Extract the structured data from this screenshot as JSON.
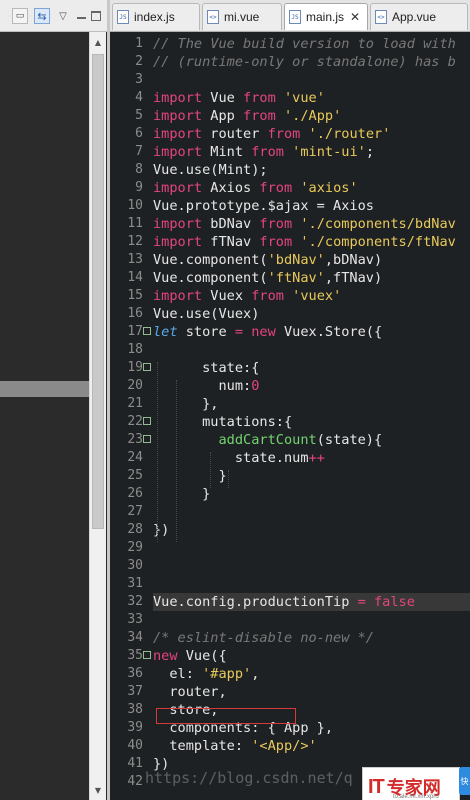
{
  "explorer": {
    "toolbar": {
      "collapse_icon": "collapse-all-icon",
      "link_icon": "link-with-editor-icon",
      "menu_icon": "view-menu-icon",
      "minimize_icon": "minimize-icon",
      "maximize_icon": "maximize-icon"
    },
    "scroll_up_glyph": "▲",
    "scroll_down_glyph": "▼"
  },
  "tabs": [
    {
      "label": "index.js",
      "icon": "js-file-icon",
      "active": false
    },
    {
      "label": "mi.vue",
      "icon": "vue-file-icon",
      "active": false
    },
    {
      "label": "main.js",
      "icon": "js-file-icon",
      "active": true,
      "close": "✕"
    },
    {
      "label": "App.vue",
      "icon": "vue-file-icon",
      "active": false
    }
  ],
  "editor": {
    "lines": [
      {
        "n": "1",
        "tokens": [
          [
            "com",
            "// The Vue build version to load with"
          ]
        ]
      },
      {
        "n": "2",
        "tokens": [
          [
            "com",
            "// (runtime-only or standalone) has b"
          ]
        ]
      },
      {
        "n": "3",
        "tokens": []
      },
      {
        "n": "4",
        "tokens": [
          [
            "kw",
            "import"
          ],
          [
            "txt",
            " Vue "
          ],
          [
            "kw",
            "from"
          ],
          [
            "txt",
            " "
          ],
          [
            "str",
            "'vue'"
          ]
        ]
      },
      {
        "n": "5",
        "tokens": [
          [
            "kw",
            "import"
          ],
          [
            "txt",
            " App "
          ],
          [
            "kw",
            "from"
          ],
          [
            "txt",
            " "
          ],
          [
            "str",
            "'./App'"
          ]
        ]
      },
      {
        "n": "6",
        "tokens": [
          [
            "kw",
            "import"
          ],
          [
            "txt",
            " router "
          ],
          [
            "kw",
            "from"
          ],
          [
            "txt",
            " "
          ],
          [
            "str",
            "'./router'"
          ]
        ]
      },
      {
        "n": "7",
        "tokens": [
          [
            "kw",
            "import"
          ],
          [
            "txt",
            " Mint "
          ],
          [
            "kw",
            "from"
          ],
          [
            "txt",
            " "
          ],
          [
            "str",
            "'mint-ui'"
          ],
          [
            "txt",
            ";"
          ]
        ]
      },
      {
        "n": "8",
        "tokens": [
          [
            "txt",
            "Vue.use(Mint);"
          ]
        ]
      },
      {
        "n": "9",
        "tokens": [
          [
            "kw",
            "import"
          ],
          [
            "txt",
            " Axios "
          ],
          [
            "kw",
            "from"
          ],
          [
            "txt",
            " "
          ],
          [
            "str",
            "'axios'"
          ]
        ]
      },
      {
        "n": "10",
        "tokens": [
          [
            "txt",
            "Vue.prototype.$ajax = Axios"
          ]
        ]
      },
      {
        "n": "11",
        "tokens": [
          [
            "kw",
            "import"
          ],
          [
            "txt",
            " bDNav "
          ],
          [
            "kw",
            "from"
          ],
          [
            "txt",
            " "
          ],
          [
            "str",
            "'./components/bdNav"
          ]
        ]
      },
      {
        "n": "12",
        "tokens": [
          [
            "kw",
            "import"
          ],
          [
            "txt",
            " fTNav "
          ],
          [
            "kw",
            "from"
          ],
          [
            "txt",
            " "
          ],
          [
            "str",
            "'./components/ftNav"
          ]
        ]
      },
      {
        "n": "13",
        "tokens": [
          [
            "txt",
            "Vue.component("
          ],
          [
            "str",
            "'bdNav'"
          ],
          [
            "txt",
            ",bDNav)"
          ]
        ]
      },
      {
        "n": "14",
        "tokens": [
          [
            "txt",
            "Vue.component("
          ],
          [
            "str",
            "'ftNav'"
          ],
          [
            "txt",
            ",fTNav)"
          ]
        ]
      },
      {
        "n": "15",
        "tokens": [
          [
            "kw",
            "import"
          ],
          [
            "txt",
            " Vuex "
          ],
          [
            "kw",
            "from"
          ],
          [
            "txt",
            " "
          ],
          [
            "str",
            "'vuex'"
          ]
        ]
      },
      {
        "n": "16",
        "tokens": [
          [
            "txt",
            "Vue.use(Vuex)"
          ]
        ]
      },
      {
        "n": "17",
        "fold": true,
        "tokens": [
          [
            "kwi",
            "let"
          ],
          [
            "txt",
            " store "
          ],
          [
            "op",
            "="
          ],
          [
            "txt",
            " "
          ],
          [
            "kw",
            "new"
          ],
          [
            "txt",
            " Vuex.Store({"
          ]
        ]
      },
      {
        "n": "18",
        "tokens": []
      },
      {
        "n": "19",
        "fold": true,
        "tokens": [
          [
            "txt",
            "      state:{"
          ]
        ]
      },
      {
        "n": "20",
        "tokens": [
          [
            "txt",
            "        num:"
          ],
          [
            "num",
            "0"
          ]
        ]
      },
      {
        "n": "21",
        "tokens": [
          [
            "txt",
            "      },"
          ]
        ]
      },
      {
        "n": "22",
        "fold": true,
        "tokens": [
          [
            "txt",
            "      mutations:{"
          ]
        ]
      },
      {
        "n": "23",
        "fold": true,
        "tokens": [
          [
            "txt",
            "        "
          ],
          [
            "fn",
            "addCartCount"
          ],
          [
            "txt",
            "(state){"
          ]
        ]
      },
      {
        "n": "24",
        "tokens": [
          [
            "txt",
            "          state.num"
          ],
          [
            "op",
            "++"
          ]
        ]
      },
      {
        "n": "25",
        "tokens": [
          [
            "txt",
            "        }"
          ]
        ]
      },
      {
        "n": "26",
        "tokens": [
          [
            "txt",
            "      }"
          ]
        ]
      },
      {
        "n": "27",
        "tokens": []
      },
      {
        "n": "28",
        "tokens": [
          [
            "txt",
            "})"
          ]
        ]
      },
      {
        "n": "29",
        "tokens": []
      },
      {
        "n": "30",
        "tokens": []
      },
      {
        "n": "31",
        "tokens": []
      },
      {
        "n": "32",
        "highlight": true,
        "tokens": [
          [
            "txt",
            "Vue.config.productionTip "
          ],
          [
            "op",
            "="
          ],
          [
            "txt",
            " "
          ],
          [
            "kw",
            "false"
          ]
        ]
      },
      {
        "n": "33",
        "tokens": []
      },
      {
        "n": "34",
        "tokens": [
          [
            "com",
            "/* eslint-disable no-new */"
          ]
        ]
      },
      {
        "n": "35",
        "fold": true,
        "tokens": [
          [
            "kw",
            "new"
          ],
          [
            "txt",
            " Vue({"
          ]
        ]
      },
      {
        "n": "36",
        "tokens": [
          [
            "txt",
            "  el: "
          ],
          [
            "str",
            "'#app'"
          ],
          [
            "txt",
            ","
          ]
        ]
      },
      {
        "n": "37",
        "tokens": [
          [
            "txt",
            "  router,"
          ]
        ]
      },
      {
        "n": "38",
        "tokens": [
          [
            "txt",
            "  store,"
          ]
        ]
      },
      {
        "n": "39",
        "tokens": [
          [
            "txt",
            "  components: { App },"
          ]
        ]
      },
      {
        "n": "40",
        "tokens": [
          [
            "txt",
            "  template: "
          ],
          [
            "str",
            "'<App/>'"
          ]
        ]
      },
      {
        "n": "41",
        "tokens": [
          [
            "txt",
            "})"
          ]
        ]
      },
      {
        "n": "42",
        "tokens": []
      }
    ]
  },
  "overlay": {
    "watermark": "https://blog.csdn.net/q",
    "logo_it": "IT",
    "logo_cn": "专家网",
    "logo_url": "to.ale.ml.xm.xpro",
    "side_tag": "快"
  },
  "colors": {
    "keyword": "#e3457d",
    "string": "#e8c95a",
    "comment": "#787878",
    "function": "#73d36f",
    "let_keyword": "#59a9e8",
    "editor_bg": "#1e2124",
    "current_line_bg": "#383838",
    "annotation_box": "#d43a3a"
  }
}
